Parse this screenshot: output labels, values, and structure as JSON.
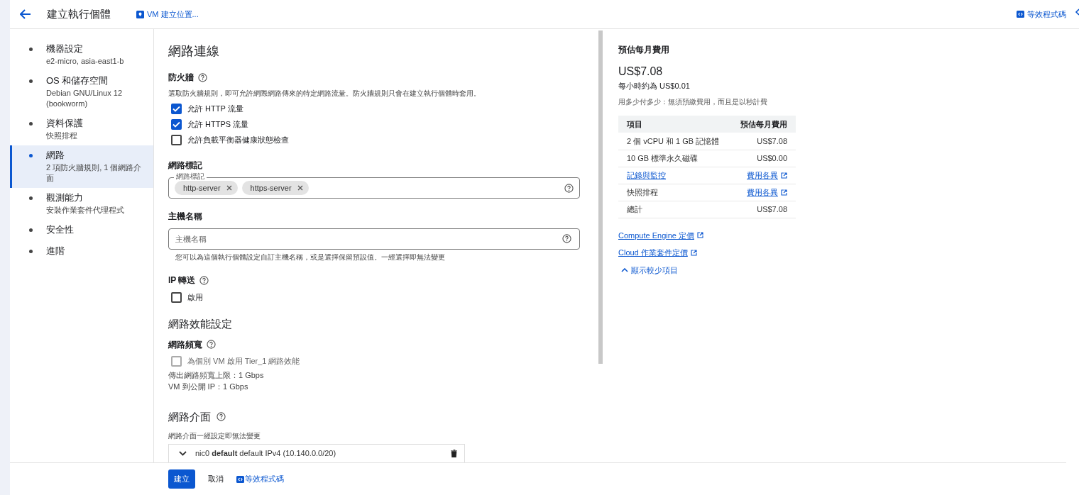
{
  "header": {
    "title": "建立執行個體",
    "location_link": "VM 建立位置...",
    "equiv_code": "等效程式碼"
  },
  "sidebar": {
    "items": [
      {
        "label": "機器設定",
        "detail": "e2-micro, asia-east1-b",
        "selected": false
      },
      {
        "label": "OS 和儲存空間",
        "detail": "Debian GNU/Linux 12 (bookworm)",
        "selected": false
      },
      {
        "label": "資料保護",
        "detail": "快照排程",
        "selected": false
      },
      {
        "label": "網路",
        "detail": "2 項防火牆規則, 1 個網路介面",
        "selected": true
      },
      {
        "label": "觀測能力",
        "detail": "安裝作業套件代理程式",
        "selected": false
      },
      {
        "label": "安全性",
        "selected": false
      },
      {
        "label": "進階",
        "selected": false
      }
    ]
  },
  "main": {
    "heading": "網路連線",
    "firewall": {
      "label": "防火牆",
      "description": "選取防火牆規則，即可允許網際網路傳來的特定網路流量。防火牆規則只會在建立執行個體時套用。",
      "options": [
        {
          "label": "允許 HTTP 流量",
          "checked": true
        },
        {
          "label": "允許 HTTPS 流量",
          "checked": true
        },
        {
          "label": "允許負載平衡器健康狀態檢查",
          "checked": false
        }
      ]
    },
    "tags": {
      "label": "網路標記",
      "field_label": "網路標記",
      "chips": [
        "http-server",
        "https-server"
      ]
    },
    "hostname": {
      "label": "主機名稱",
      "placeholder": "主機名稱",
      "hint": "您可以為這個執行個體設定自訂主機名稱，或是選擇保留預設值。一經選擇即無法變更"
    },
    "ip_forwarding": {
      "label": "IP 轉送",
      "option": {
        "label": "啟用",
        "checked": false
      }
    },
    "performance": {
      "heading": "網路效能設定",
      "bandwidth_label": "網路頻寬",
      "option": {
        "label": "為個別 VM 啟用 Tier_1 網路效能",
        "checked": false,
        "disabled": true
      },
      "lines": [
        "傳出網路頻寬上限：1 Gbps",
        "VM 到公開 IP：1 Gbps"
      ]
    },
    "interfaces": {
      "heading": "網路介面",
      "note": "網路介面一經設定即無法變更",
      "rows": [
        {
          "text": "nic0 **default** default IPv4 (10.140.0.0/20)"
        }
      ]
    }
  },
  "cost": {
    "title": "預估每月費用",
    "amount": "US$7.08",
    "hourly": "每小時約為 US$0.01",
    "note": "用多少付多少：無須預繳費用，而且是以秒計費",
    "columns": [
      "項目",
      "預估每月費用"
    ],
    "rows": [
      {
        "item": "2 個 vCPU 和 1 GB 記憶體",
        "cost": "US$7.08",
        "item_link": false,
        "cost_link": false
      },
      {
        "item": "10 GB 標準永久磁碟",
        "cost": "US$0.00",
        "item_link": false,
        "cost_link": false
      },
      {
        "item": "記錄與監控",
        "cost": "費用各異",
        "item_link": true,
        "cost_link": true
      },
      {
        "item": "快照排程",
        "cost": "費用各異",
        "item_link": false,
        "cost_link": true
      },
      {
        "item": "總計",
        "cost": "US$7.08",
        "item_link": false,
        "cost_link": false
      }
    ],
    "links": [
      "Compute Engine 定價",
      "Cloud 作業套件定價"
    ],
    "toggle": "顯示較少項目"
  },
  "footer": {
    "create": "建立",
    "cancel": "取消",
    "equiv_code": "等效程式碼"
  }
}
